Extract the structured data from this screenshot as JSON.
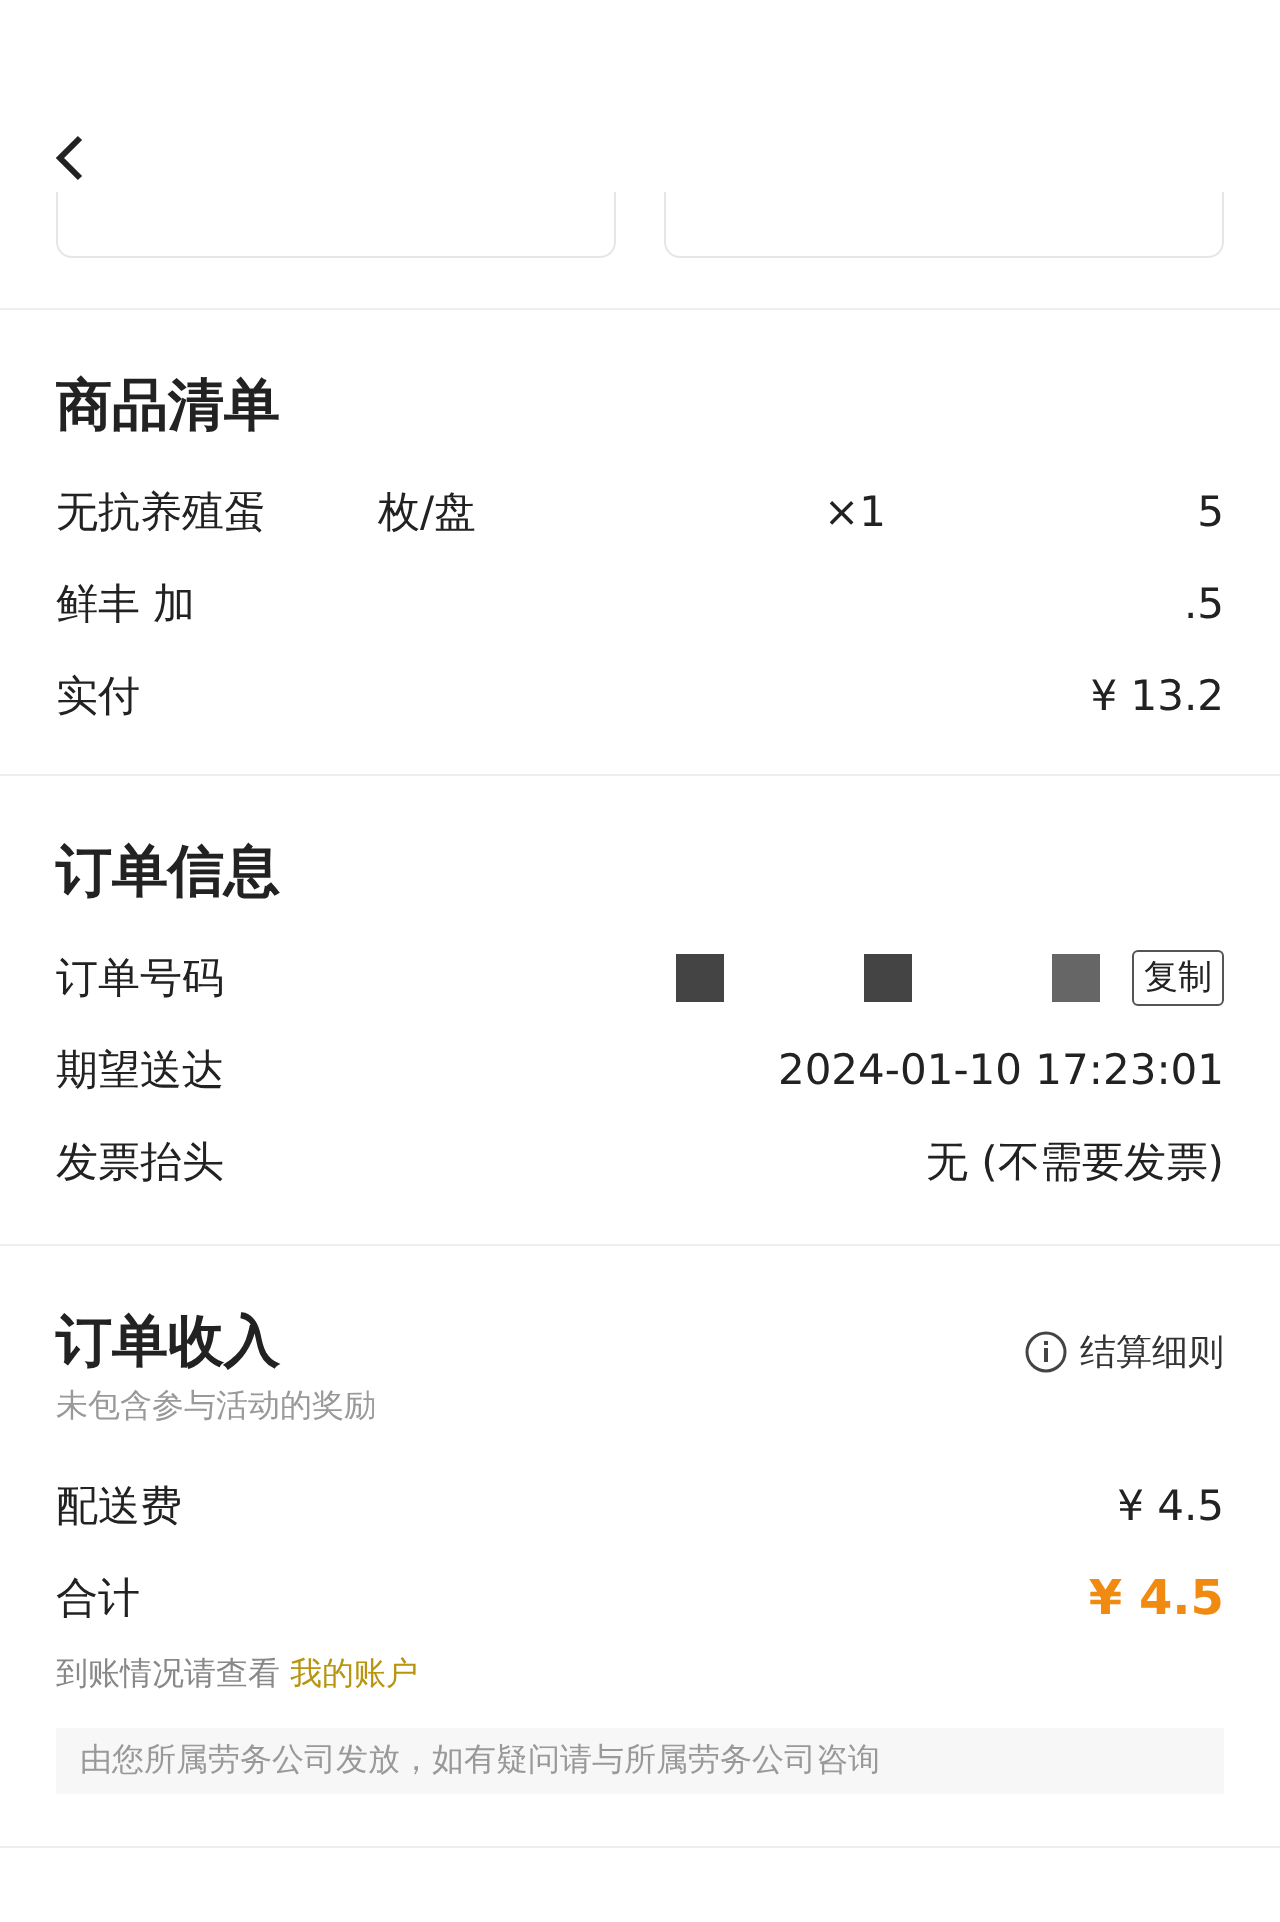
{
  "goods": {
    "title": "商品清单",
    "items": [
      {
        "name": "无抗养殖蛋",
        "spec": "枚/盘",
        "qty": "×1",
        "price": "5"
      },
      {
        "name": "鲜丰 加",
        "price": ".5"
      }
    ],
    "paid": {
      "label": "实付",
      "value": "¥ 13.2"
    }
  },
  "order_info": {
    "title": "订单信息",
    "rows": [
      {
        "kind": "copy",
        "label": "订单号码",
        "button": "复制"
      },
      {
        "kind": "text",
        "label": "期望送达",
        "value": "2024-01-10 17:23:01"
      },
      {
        "kind": "text",
        "label": "发票抬头",
        "value": "无 (不需要发票)"
      }
    ]
  },
  "income": {
    "title": "订单收入",
    "rules_link": "结算细则",
    "subtitle": "未包含参与活动的奖励",
    "rows": [
      {
        "label": "配送费",
        "value": "¥ 4.5",
        "kind": "plain"
      },
      {
        "label": "合计",
        "value": "¥ 4.5",
        "kind": "total"
      }
    ],
    "account_note": "到账情况请查看",
    "account_link": "我的账户",
    "notice": "由您所属劳务公司发放，如有疑问请与所属劳务公司咨询"
  }
}
